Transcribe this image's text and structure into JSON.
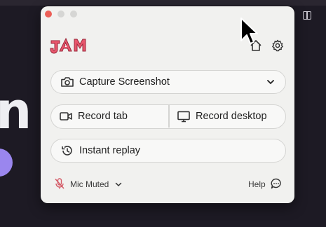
{
  "window": {
    "buttons": {
      "capture_label": "Capture Screenshot",
      "record_tab_label": "Record tab",
      "record_desktop_label": "Record desktop",
      "replay_label": "Instant replay"
    },
    "footer": {
      "mic_label": "Mic Muted",
      "help_label": "Help"
    }
  },
  "icons": [
    "home-icon",
    "gear-icon",
    "camera-icon",
    "chevron-down-icon",
    "video-camera-icon",
    "monitor-icon",
    "history-icon",
    "mic-muted-icon",
    "chat-bubble-icon"
  ],
  "colors": {
    "logo": "#e8566c",
    "window_bg": "#f1f1ef",
    "close": "#ec5f57"
  }
}
